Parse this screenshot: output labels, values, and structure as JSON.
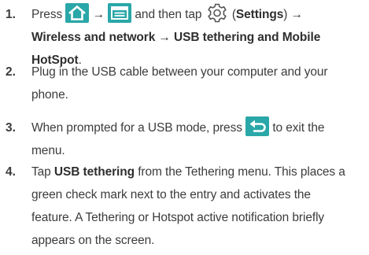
{
  "steps": [
    {
      "number": "1.",
      "press": "Press",
      "arrow1": "→",
      "and_then_tap": "and then tap",
      "settings_label": "Settings",
      "arrow2": "→",
      "path_line2": "Wireless and network → USB tethering and Mobile HotSpot",
      "period": ".",
      "icons": [
        "home-icon",
        "menu-icon",
        "settings-gear-icon"
      ]
    },
    {
      "number": "2.",
      "line1": "Plug in the USB cable between your computer and your",
      "line2": "phone."
    },
    {
      "number": "3.",
      "before_icon": "When prompted for a USB mode, press",
      "after_icon": "to exit the",
      "line2": "menu.",
      "icons": [
        "back-icon"
      ]
    },
    {
      "number": "4.",
      "tap": "Tap",
      "bold": "USB tethering",
      "rest_line1": "from the Tethering menu. This places a",
      "line2": "green check mark next to the entry and activates the",
      "line3": "feature. A Tethering or Hotspot active notification briefly",
      "line4": "appears on the screen."
    }
  ],
  "colors": {
    "icon_bg": "#2aa7a8",
    "text": "#3c3c3c",
    "gear": "#555555"
  }
}
